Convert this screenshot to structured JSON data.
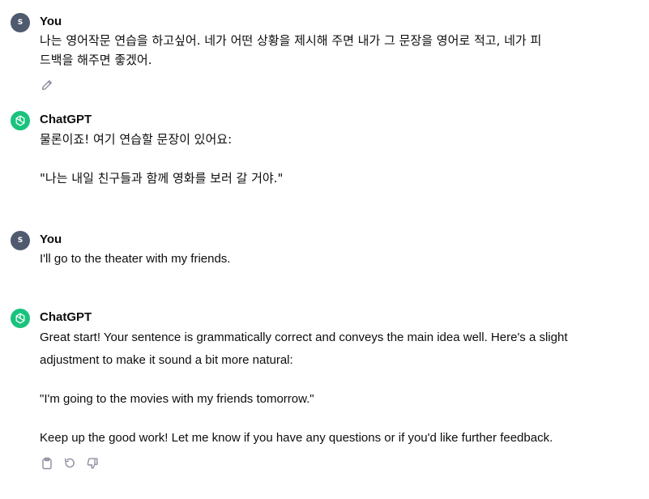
{
  "conversation": [
    {
      "role": "user",
      "avatar_letter": "S",
      "author": "You",
      "lines": [
        "나는 영어작문 연습을 하고싶어. 네가 어떤 상황을 제시해 주면 내가 그 문장을 영어로 적고, 네가 피",
        "드백을 해주면 좋겠어."
      ]
    },
    {
      "role": "assistant",
      "author": "ChatGPT",
      "lines": [
        "물론이죠! 여기 연습할 문장이 있어요:",
        "",
        "\"나는 내일 친구들과 함께 영화를 보러 갈 거야.\""
      ]
    },
    {
      "role": "user",
      "avatar_letter": "S",
      "author": "You",
      "lines": [
        "I'll go to the theater with my friends."
      ]
    },
    {
      "role": "assistant",
      "author": "ChatGPT",
      "lines": [
        "Great start! Your sentence is grammatically correct and conveys the main idea well. Here's a slight",
        "adjustment to make it sound a bit more natural:",
        "",
        "\"I'm going to the movies with my friends tomorrow.\"",
        "",
        "Keep up the good work! Let me know if you have any questions or if you'd like further feedback."
      ]
    }
  ],
  "icons": {
    "edit": "pencil-icon",
    "copy": "clipboard-icon",
    "regenerate": "refresh-icon",
    "dislike": "thumbs-down-icon",
    "assistant_logo": "openai-logo-icon"
  },
  "colors": {
    "user_avatar": "#4f5a6e",
    "assistant_avatar": "#19c37d",
    "text": "#0d0d0d",
    "icon": "#8e8ea0"
  }
}
